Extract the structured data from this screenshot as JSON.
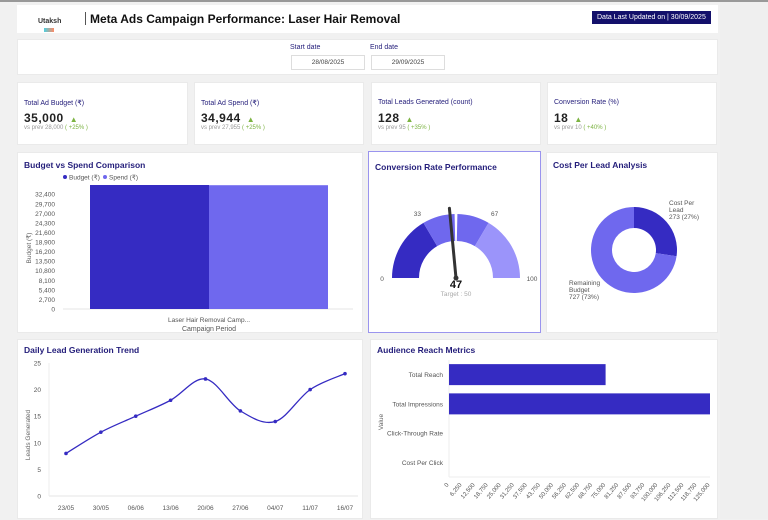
{
  "header": {
    "logo_text": "Utaksh",
    "title": "Meta Ads Campaign Performance: Laser Hair Removal",
    "updated": "Data Last Updated on | 30/09/2025"
  },
  "filters": {
    "start_label": "Start date",
    "start_value": "28/08/2025",
    "end_label": "End date",
    "end_value": "29/09/2025"
  },
  "kpis": [
    {
      "label": "Total Ad Budget (₹)",
      "value": "35,000",
      "prev": "vs prev 28,000",
      "change": "( +25% )"
    },
    {
      "label": "Total Ad Spend (₹)",
      "value": "34,944",
      "prev": "vs prev 27,955",
      "change": "( +25% )"
    },
    {
      "label": "Total Leads Generated (count)",
      "value": "128",
      "prev": "vs prev 95",
      "change": "( +35% )"
    },
    {
      "label": "Conversion Rate (%)",
      "value": "18",
      "prev": "vs prev 10",
      "change": "( +40% )"
    }
  ],
  "colors": {
    "dark": "#352bc2",
    "mid": "#6f68ee",
    "light": "#9b94fa",
    "title": "#231d7a",
    "up": "#7cb342"
  },
  "chart_data": [
    {
      "id": "budget",
      "type": "bar",
      "title": "Budget vs Spend Comparison",
      "categories": [
        "Laser Hair Removal Camp..."
      ],
      "series": [
        {
          "name": "Budget (₹)",
          "values": [
            35000
          ]
        },
        {
          "name": "Spend (₹)",
          "values": [
            34944
          ]
        }
      ],
      "xlabel": "Campaign Period",
      "ylabel": "Budget (₹)",
      "yticks": [
        0,
        2700,
        5400,
        8100,
        10800,
        13500,
        16200,
        18900,
        21600,
        24300,
        27000,
        29700,
        32400
      ],
      "ylim": [
        0,
        35000
      ],
      "legend": "top-left"
    },
    {
      "id": "gauge",
      "type": "gauge",
      "title": "Conversion Rate Performance",
      "value": 47,
      "target_label": "Target : 50",
      "target": 50,
      "range": [
        0,
        100
      ],
      "ticks": [
        0,
        33,
        67,
        100
      ]
    },
    {
      "id": "cpl",
      "type": "pie",
      "title": "Cost Per Lead Analysis",
      "slices": [
        {
          "label": "Cost Per Lead",
          "value": 273,
          "text": "273 (27%)"
        },
        {
          "label": "Remaining Budget",
          "value": 727,
          "text": "727 (73%)"
        }
      ]
    },
    {
      "id": "trend",
      "type": "line",
      "title": "Daily Lead Generation Trend",
      "categories": [
        "23/05",
        "30/05",
        "06/06",
        "13/06",
        "20/06",
        "27/06",
        "04/07",
        "11/07",
        "16/07"
      ],
      "values": [
        8,
        12,
        15,
        18,
        22,
        16,
        14,
        20,
        23
      ],
      "ylabel": "Leads Generated",
      "ylim": [
        0,
        25
      ],
      "yticks": [
        0,
        5,
        10,
        15,
        20,
        25
      ]
    },
    {
      "id": "reach",
      "type": "bar",
      "orientation": "horizontal",
      "title": "Audience Reach Metrics",
      "categories": [
        "Total Reach",
        "Total Impressions",
        "Click-Through Rate",
        "Cost Per Click"
      ],
      "values": [
        75000,
        125000,
        0,
        0
      ],
      "ylabel": "Value",
      "xlim": [
        0,
        125000
      ],
      "xticks": [
        "0",
        "6,250",
        "12,500",
        "18,750",
        "25,000",
        "31,250",
        "37,500",
        "43,750",
        "50,000",
        "56,250",
        "62,500",
        "68,750",
        "75,000",
        "81,250",
        "87,500",
        "93,750",
        "100,000",
        "106,250",
        "112,500",
        "118,750",
        "125,000"
      ]
    }
  ]
}
